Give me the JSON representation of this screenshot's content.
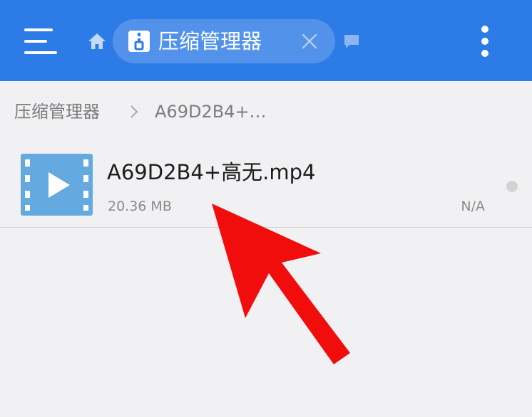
{
  "colors": {
    "toolbar_bg": "#2d7be6",
    "page_bg": "#f1f1f3",
    "video_icon": "#64a9e0",
    "annotation_arrow": "#f20d0d"
  },
  "header": {
    "menu_icon": "hamburger-menu-icon",
    "home_icon": "home-icon",
    "tab": {
      "icon": "archive-manager-icon",
      "title": "压缩管理器",
      "close_icon": "close-icon"
    },
    "windows_icon": "window-list-icon",
    "more_icon": "more-vertical-icon"
  },
  "breadcrumb": {
    "items": [
      "压缩管理器",
      "A69D2B4+…"
    ],
    "separator_icon": "chevron-right-icon"
  },
  "files": [
    {
      "icon": "video-file-icon",
      "name": "A69D2B4+高无.mp4",
      "size": "20.36 MB",
      "date": "N/A"
    }
  ],
  "annotation": {
    "icon": "red-arrow-pointer"
  }
}
